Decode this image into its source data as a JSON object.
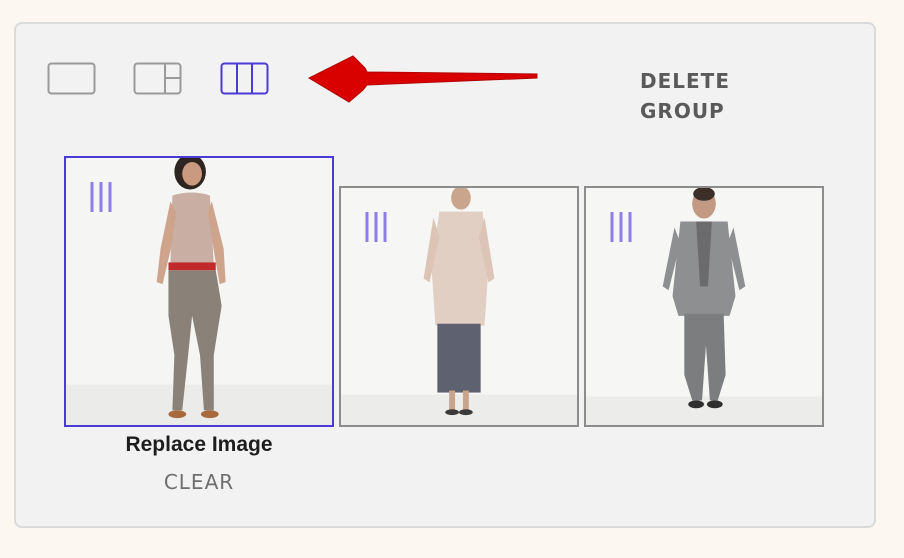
{
  "toolbar": {
    "layouts": [
      {
        "name": "single",
        "icon": "single-column-layout-icon",
        "selected": false
      },
      {
        "name": "split",
        "icon": "split-layout-icon",
        "selected": false
      },
      {
        "name": "thirds",
        "icon": "three-column-layout-icon",
        "selected": true
      }
    ],
    "delete_group_label": "DELETE GROUP",
    "accent_color": "#4b3bd6",
    "annotation_arrow_color": "#e00000"
  },
  "images": [
    {
      "subject": "woman in beige top, red belt, grey pants",
      "selected": true,
      "handle_icon": "drag-handle-icon"
    },
    {
      "subject": "person in floral shirt and dark skirt",
      "selected": false,
      "handle_icon": "drag-handle-icon"
    },
    {
      "subject": "man in grey suit",
      "selected": false,
      "handle_icon": "drag-handle-icon"
    }
  ],
  "actions": {
    "replace_image_label": "Replace Image",
    "clear_label": "CLEAR"
  }
}
